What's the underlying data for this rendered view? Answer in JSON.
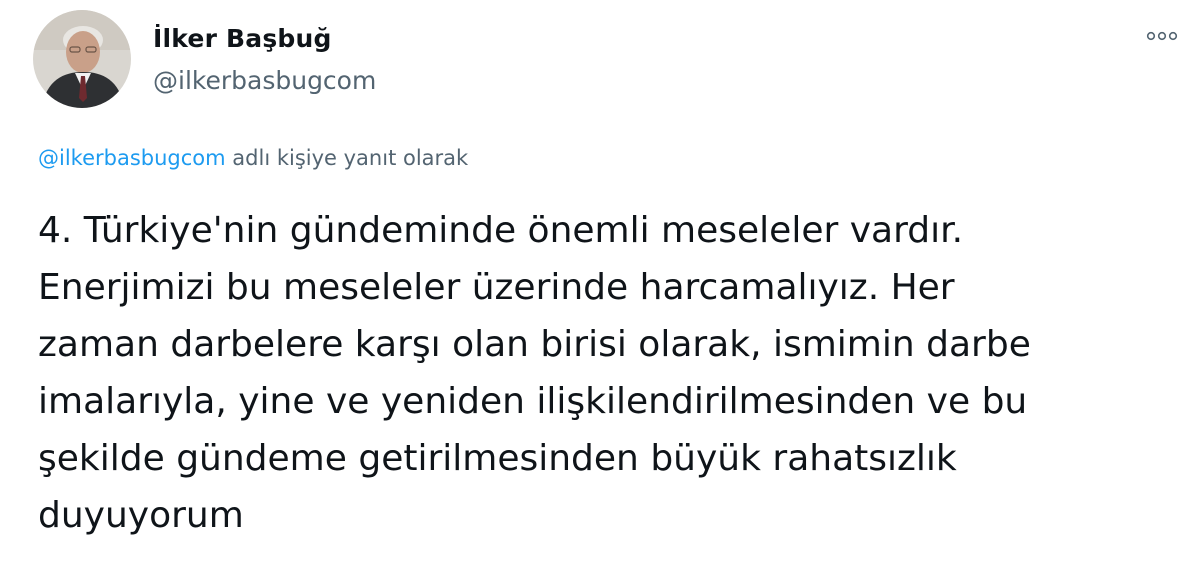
{
  "author": {
    "display_name": "İlker Başbuğ",
    "handle": "@ilkerbasbugcom"
  },
  "reply_context": {
    "handle": "@ilkerbasbugcom",
    "suffix": "adlı kişiye yanıt olarak"
  },
  "tweet": {
    "lines": [
      "4. Türkiye'nin gündeminde önemli meseleler vardır.",
      "Enerjimizi bu meseleler üzerinde harcamalıyız. Her",
      "zaman darbelere karşı olan birisi olarak, ismimin darbe",
      "imalarıyla, yine ve yeniden ilişkilendirilmesinden ve bu",
      "şekilde gündeme getirilmesinden büyük rahatsızlık",
      "duyuyorum"
    ]
  },
  "icons": {
    "more": "more-options-icon",
    "avatar": "profile-photo"
  },
  "colors": {
    "text_primary": "#0f1419",
    "text_secondary": "#536471",
    "link": "#1d9bf0"
  }
}
